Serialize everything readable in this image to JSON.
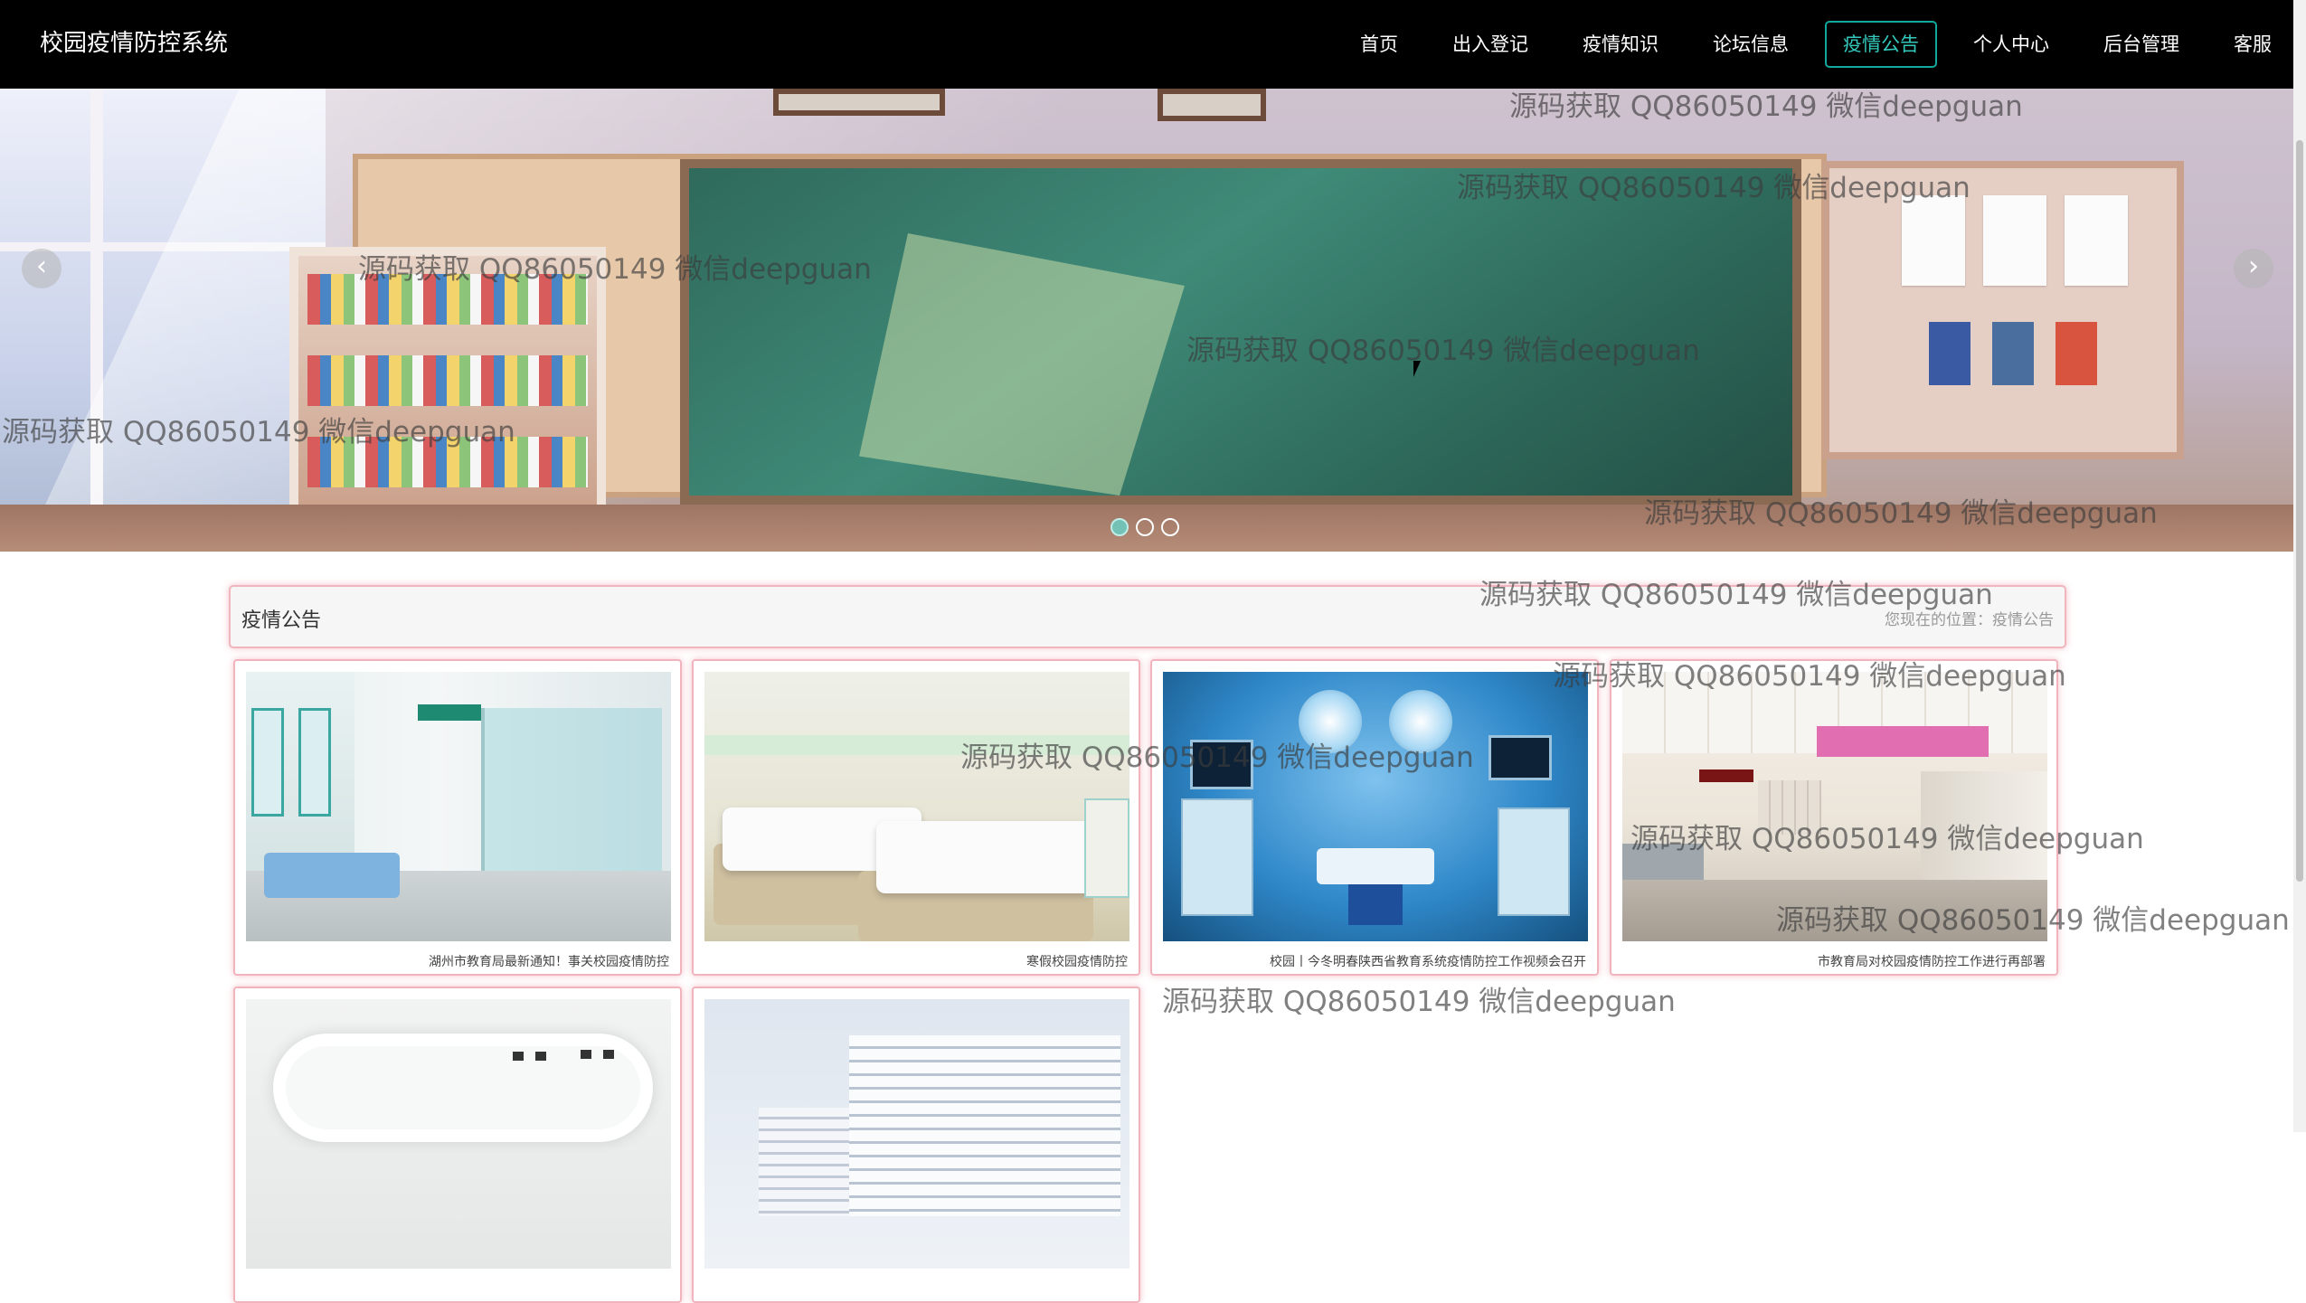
{
  "app": {
    "title": "校园疫情防控系统"
  },
  "nav": {
    "items": [
      {
        "label": "首页",
        "active": false
      },
      {
        "label": "出入登记",
        "active": false
      },
      {
        "label": "疫情知识",
        "active": false
      },
      {
        "label": "论坛信息",
        "active": false
      },
      {
        "label": "疫情公告",
        "active": true
      },
      {
        "label": "个人中心",
        "active": false
      },
      {
        "label": "后台管理",
        "active": false
      },
      {
        "label": "客服",
        "active": false
      }
    ]
  },
  "carousel": {
    "prev_icon": "‹",
    "next_icon": "›",
    "slide_count": 3,
    "active_slide": 1
  },
  "section": {
    "title": "疫情公告",
    "breadcrumb": "您现在的位置：疫情公告"
  },
  "cards": [
    {
      "caption": "湖州市教育局最新通知！事关校园疫情防控",
      "image": "hospital-corridor"
    },
    {
      "caption": "寒假校园疫情防控",
      "image": "hospital-beds"
    },
    {
      "caption": "校园丨今冬明春陕西省教育系统疫情防控工作视频会召开",
      "image": "operating-room"
    },
    {
      "caption": "市教育局对校园疫情防控工作进行再部署",
      "image": "hospital-hallway"
    },
    {
      "caption": "",
      "image": "ceiling-light"
    },
    {
      "caption": "",
      "image": "hospital-building"
    }
  ],
  "watermark": {
    "text": "源码获取 QQ86050149 微信deepguan"
  },
  "colors": {
    "nav_bg": "#000000",
    "accent": "#13a89e",
    "card_border": "#f1b3bc"
  }
}
